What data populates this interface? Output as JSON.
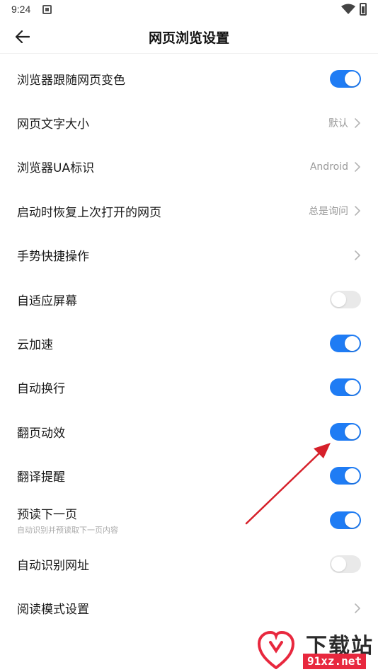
{
  "status_bar": {
    "time": "9:24"
  },
  "header": {
    "title": "网页浏览设置"
  },
  "settings": [
    {
      "label": "浏览器跟随网页变色",
      "type": "toggle",
      "on": true
    },
    {
      "label": "网页文字大小",
      "type": "nav",
      "value": "默认"
    },
    {
      "label": "浏览器UA标识",
      "type": "nav",
      "value": "Android"
    },
    {
      "label": "启动时恢复上次打开的网页",
      "type": "nav",
      "value": "总是询问"
    },
    {
      "label": "手势快捷操作",
      "type": "nav",
      "value": ""
    },
    {
      "label": "自适应屏幕",
      "type": "toggle",
      "on": false
    },
    {
      "label": "云加速",
      "type": "toggle",
      "on": true
    },
    {
      "label": "自动换行",
      "type": "toggle",
      "on": true
    },
    {
      "label": "翻页动效",
      "type": "toggle",
      "on": true
    },
    {
      "label": "翻译提醒",
      "type": "toggle",
      "on": true
    },
    {
      "label": "预读下一页",
      "sublabel": "自动识别并预读取下一页内容",
      "type": "toggle",
      "on": true
    },
    {
      "label": "自动识别网址",
      "type": "toggle",
      "on": false
    },
    {
      "label": "阅读模式设置",
      "type": "nav",
      "value": ""
    }
  ],
  "watermark": {
    "title": "下载站",
    "url": "91xz.net"
  },
  "colors": {
    "accent": "#1f7cf4",
    "toggle_off": "#e9e9e9",
    "annotation": "#d6202a",
    "watermark_red": "#e8283e"
  }
}
